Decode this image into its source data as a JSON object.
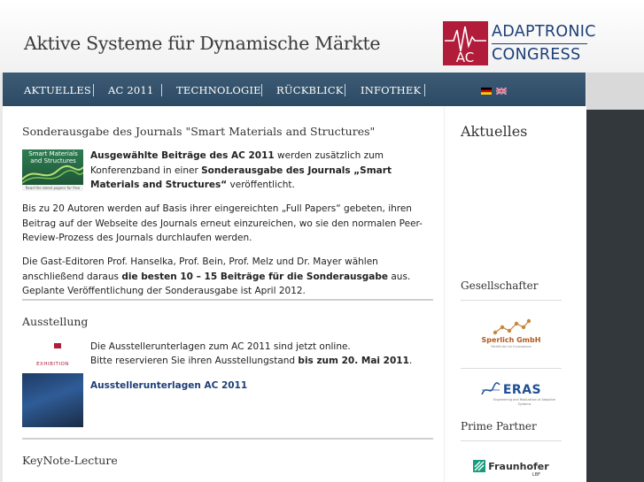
{
  "header": {
    "site_title": "Aktive Systeme für Dynamische Märkte",
    "logo": {
      "mark_text": "AC",
      "line1": "ADAPTRONIC",
      "line2": "CONGRESS",
      "brand_color": "#b01c3a",
      "text_color": "#1d3f78"
    }
  },
  "nav": {
    "items": [
      "AKTUELLES",
      "AC 2011",
      "TECHNOLOGIE",
      "RÜCKBLICK",
      "INFOTHEK"
    ],
    "flags": [
      "flag-de-icon",
      "flag-uk-icon"
    ],
    "background": "#2f4d66"
  },
  "main": {
    "section1": {
      "title": "Sonderausgabe des Journals \"Smart Materials and Structures\"",
      "thumb_title": "Smart Materials and Structures",
      "thumb_footer": "Read the latest papers for free",
      "p1_b1": "Ausgewählte Beiträge des AC 2011",
      "p1_t1": " werden zusätzlich zum Konferenzband in einer ",
      "p1_b2": "Sonderausgabe des Journals „Smart Materials and Structures“",
      "p1_t2": " veröffentlicht.",
      "p2": "Bis zu 20 Autoren werden auf Basis ihrer eingereichten „Full Papers“ gebeten, ihren Beitrag auf der Webseite des Journals erneut einzureichen, wo sie den normalen Peer-Review-Prozess des Journals durchlaufen werden.",
      "p3_t1": "Die Gast-Editoren Prof. Hanselka, Prof. Bein, Prof. Melz und Dr. Mayer wählen anschließend daraus ",
      "p3_b1": "die besten 10 – 15 Beiträge für die Sonderausgabe",
      "p3_t2": " aus. Geplante Veröffentlichung der Sonderausgabe ist April 2012."
    },
    "section2": {
      "title": "Ausstellung",
      "thumb_label": "EXHIBITION",
      "line1": "Die Ausstellerunterlagen zum AC 2011 sind jetzt online.",
      "line2_t1": "Bitte reservieren Sie ihren Ausstellungstand ",
      "line2_b1": "bis zum 20. Mai 2011",
      "line2_t2": ".",
      "link": "Ausstellerunterlagen AC 2011"
    },
    "section3": {
      "title": "KeyNote-Lecture"
    }
  },
  "sidebar": {
    "title": "Aktuelles",
    "gesellschafter": "Gesellschafter",
    "partner1": {
      "name": "Sperlich GmbH",
      "tagline": "Pathfinder for Innovations"
    },
    "partner2": {
      "name": "ERAS",
      "tagline": "Engineering and Realization of Adaptive Systems"
    },
    "prime_partner": "Prime Partner",
    "partner3": {
      "name": "Fraunhofer",
      "sub": "LBF"
    }
  }
}
